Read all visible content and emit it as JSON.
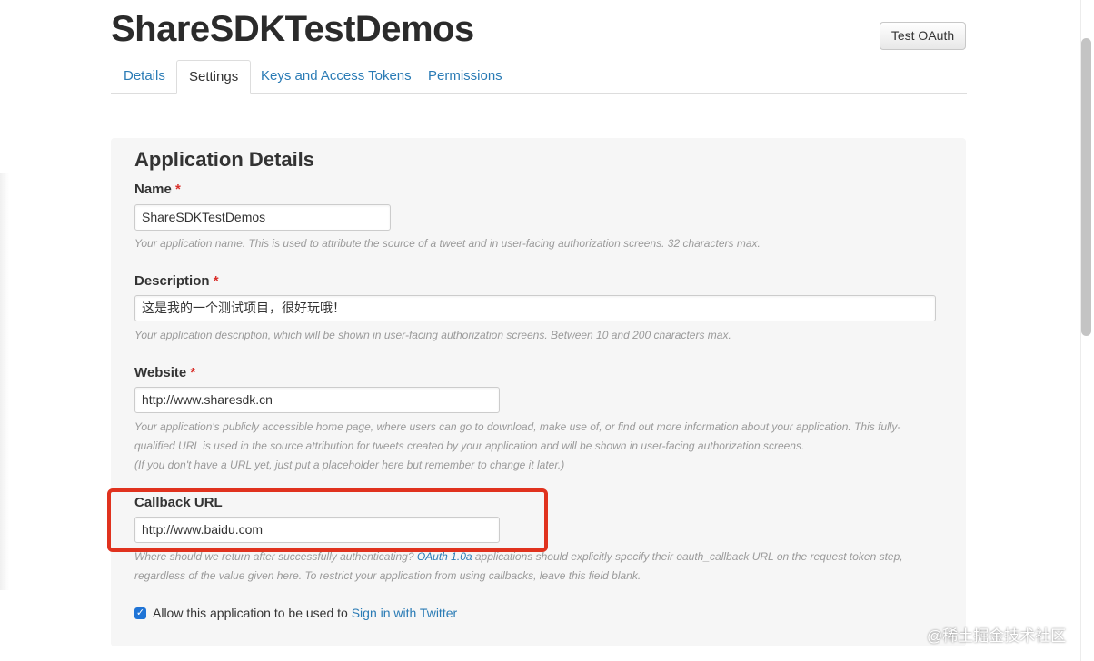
{
  "app": {
    "title": "ShareSDKTestDemos",
    "test_oauth_label": "Test OAuth"
  },
  "tabs": [
    {
      "label": "Details",
      "active": false
    },
    {
      "label": "Settings",
      "active": true
    },
    {
      "label": "Keys and Access Tokens",
      "active": false
    },
    {
      "label": "Permissions",
      "active": false
    }
  ],
  "section": {
    "title": "Application Details"
  },
  "fields": {
    "name": {
      "label": "Name",
      "required_mark": "*",
      "value": "ShareSDKTestDemos",
      "help": "Your application name. This is used to attribute the source of a tweet and in user-facing authorization screens. 32 characters max."
    },
    "description": {
      "label": "Description",
      "required_mark": "*",
      "value": "这是我的一个测试项目，很好玩哦！",
      "help": "Your application description, which will be shown in user-facing authorization screens. Between 10 and 200 characters max."
    },
    "website": {
      "label": "Website",
      "required_mark": "*",
      "value": "http://www.sharesdk.cn",
      "help_line1": "Your application's publicly accessible home page, where users can go to download, make use of, or find out more information about your application. This fully-",
      "help_line2": "qualified URL is used in the source attribution for tweets created by your application and will be shown in user-facing authorization screens.",
      "help_line3": "(If you don't have a URL yet, just put a placeholder here but remember to change it later.)"
    },
    "callback": {
      "label": "Callback URL",
      "value": "http://www.baidu.com",
      "help_part1": "Where should we return after successfully authenticating? ",
      "help_link": "OAuth 1.0a",
      "help_part2": " applications should explicitly specify their oauth_callback URL on the request token step,",
      "help_line2": "regardless of the value given here. To restrict your application from using callbacks, leave this field blank."
    }
  },
  "signin": {
    "checked": true,
    "label": "Allow this application to be used to ",
    "link": "Sign in with Twitter"
  },
  "watermark": "@稀土掘金技术社区",
  "colors": {
    "link": "#2a7bb5",
    "required": "#d9302b",
    "highlight": "#e0321e",
    "checkbox": "#1f74d6"
  }
}
